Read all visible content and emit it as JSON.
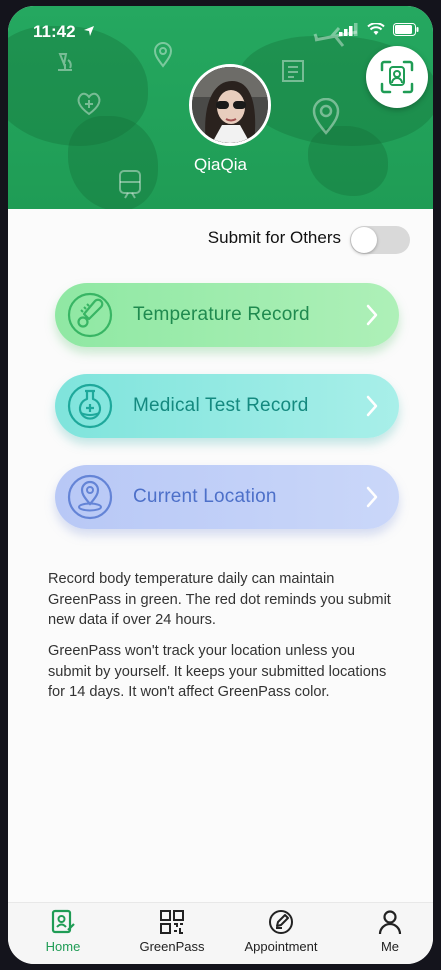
{
  "status_bar": {
    "time": "11:42"
  },
  "profile": {
    "username": "QiaQia"
  },
  "submit_others": {
    "label": "Submit for Others",
    "enabled": false
  },
  "records": [
    {
      "label": "Temperature Record",
      "icon": "thermometer-icon"
    },
    {
      "label": "Medical Test Record",
      "icon": "flask-icon"
    },
    {
      "label": "Current Location",
      "icon": "location-pin-icon"
    }
  ],
  "info": {
    "paragraph_1": "Record body temperature daily can maintain GreenPass in green. The red dot reminds you submit new data if over 24 hours.",
    "paragraph_2": "GreenPass won't track your location unless you submit by yourself. It keeps your submitted locations for 14 days. It won't affect GreenPass color."
  },
  "tabs": [
    {
      "label": "Home",
      "icon": "home-record-icon",
      "active": true
    },
    {
      "label": "GreenPass",
      "icon": "qr-code-icon",
      "active": false
    },
    {
      "label": "Appointment",
      "icon": "appointment-icon",
      "active": false
    },
    {
      "label": "Me",
      "icon": "person-icon",
      "active": false
    }
  ],
  "colors": {
    "brand_green": "#1f9c55",
    "tab_active": "#1f9c55",
    "tab_inactive": "#222222"
  }
}
